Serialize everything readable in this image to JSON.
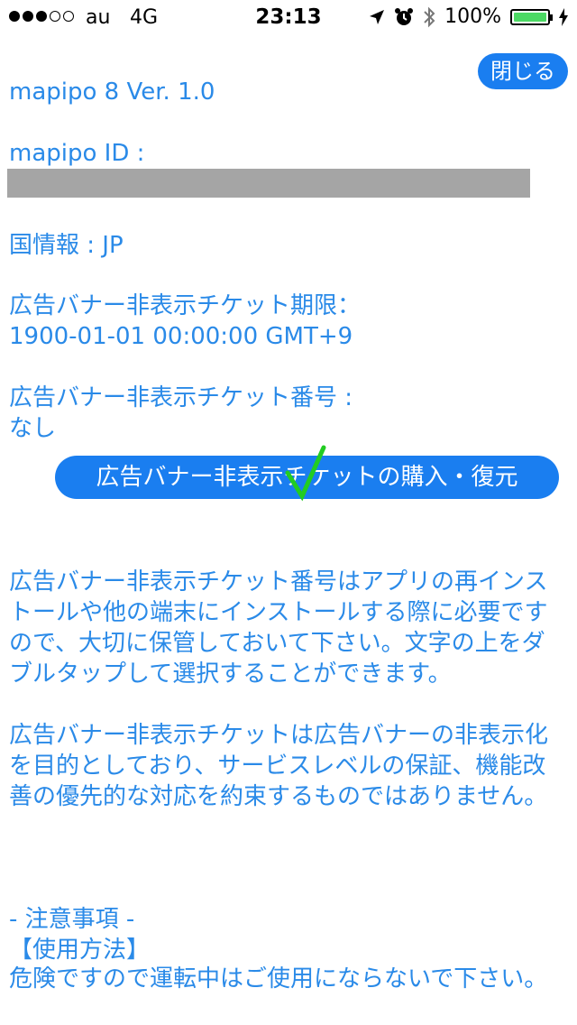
{
  "status_bar": {
    "carrier": "au",
    "network": "4G",
    "time": "23:13",
    "battery": "100%",
    "signal_bars_filled": 3,
    "signal_bars_total": 5
  },
  "header": {
    "close_label": "閉じる"
  },
  "info": {
    "app_version": "mapipo 8 Ver. 1.0",
    "mapipo_id_label": "mapipo ID :",
    "country_info": "国情報 : JP",
    "ticket_expiry_label": "広告バナー非表示チケット期限：",
    "ticket_expiry_value": "1900-01-01 00:00:00 GMT+9",
    "ticket_number_label": "広告バナー非表示チケット番号 :",
    "ticket_number_value": "なし"
  },
  "purchase_button_label": "広告バナー非表示チケットの購入・復元",
  "notes": {
    "paragraph1": "広告バナー非表示チケット番号はアプリの再インストールや他の端末にインストールする際に必要ですので、大切に保管しておいて下さい。文字の上をダブルタップして選択することができます。",
    "paragraph2": "広告バナー非表示チケットは広告バナーの非表示化を目的としており、サービスレベルの保証、機能改善の優先的な対応を約束するものではありません。",
    "caution_heading": "- 注意事項 -",
    "usage_heading": "【使用方法】",
    "usage_text": "危険ですので運転中はご使用にならないで下さい。"
  },
  "colors": {
    "accent_blue": "#1a7ef0",
    "text_blue": "#2a8ae8",
    "checkmark_green": "#22cc22",
    "redacted_gray": "#a5a5a5"
  },
  "icons": {
    "location": "location-arrow-icon",
    "alarm": "alarm-clock-icon",
    "bluetooth": "bluetooth-icon",
    "charging": "charging-bolt-icon"
  }
}
